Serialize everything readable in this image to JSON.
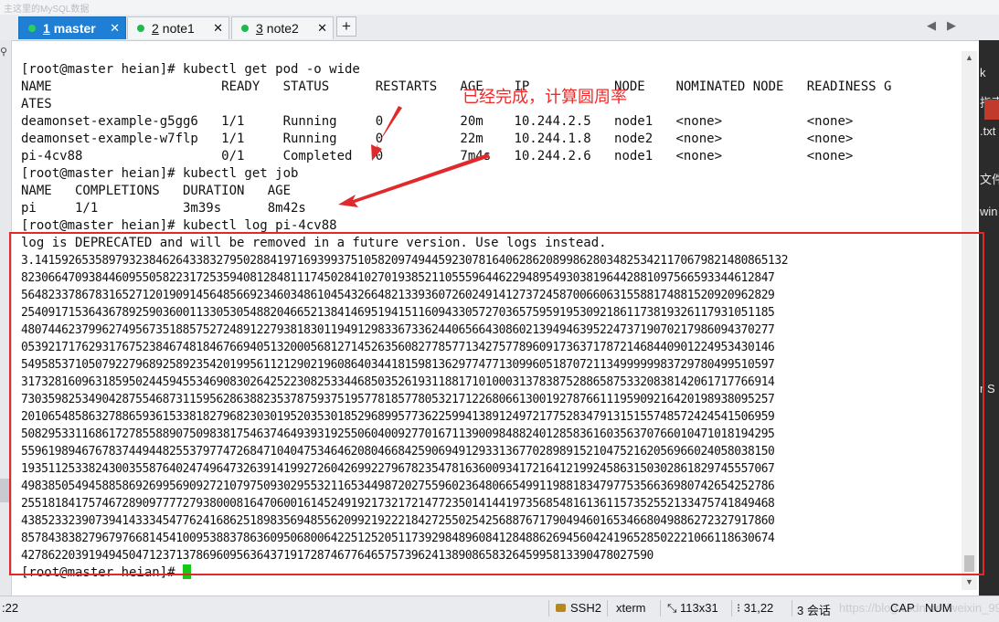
{
  "topbar": {
    "text": "主这里的MySQL数据"
  },
  "tabs": [
    {
      "number": "1",
      "label": "master",
      "active": true
    },
    {
      "number": "2",
      "label": "note1",
      "active": false
    },
    {
      "number": "3",
      "label": "note2",
      "active": false
    }
  ],
  "new_tab_label": "+",
  "terminal": {
    "lines": [
      "[root@master heian]# kubectl get pod -o wide",
      "NAME                      READY   STATUS      RESTARTS   AGE    IP           NODE    NOMINATED NODE   READINESS G",
      "ATES",
      "deamonset-example-g5gg6   1/1     Running     0          20m    10.244.2.5   node1   <none>           <none>",
      "deamonset-example-w7flp   1/1     Running     0          22m    10.244.1.8   node2   <none>           <none>",
      "pi-4cv88                  0/1     Completed   0          7m4s   10.244.2.6   node1   <none>           <none>",
      "[root@master heian]# kubectl get job",
      "NAME   COMPLETIONS   DURATION   AGE",
      "pi     1/1           3m39s      8m42s",
      "[root@master heian]# kubectl log pi-4cv88",
      "log is DEPRECATED and will be removed in a future version. Use logs instead."
    ],
    "pi_output": [
      "3.1415926535897932384626433832795028841971693993751058209749445923078164062862089986280348253421170679821480865132",
      "8230664709384460955058223172535940812848111745028410270193852110555964462294895493038196442881097566593344612847",
      "5648233786783165271201909145648566923460348610454326648213393607260249141273724587006606315588174881520920962829",
      "2540917153643678925903600113305305488204665213841469519415116094330572703657595919530921861173819326117931051185",
      "4807446237996274956735188575272489122793818301194912983367336244065664308602139494639522473719070217986094370277",
      "0539217176293176752384674818467669405132000568127145263560827785771342757789609173637178721468440901224953430146",
      "5495853710507922796892589235420199561121290219608640344181598136297747713099605187072113499999983729780499510597",
      "3173281609631859502445945534690830264252230825334468503526193118817101000313783875288658753320838142061717766914",
      "7303598253490428755468731159562863882353787593751957781857780532171226806613001927876611195909216420198938095257",
      "2010654858632788659361533818279682303019520353018529689957736225994138912497217752834791315155748572424541506959",
      "5082953311686172785588907509838175463746493931925506040092770167113900984882401285836160356370766010471018194295",
      "5596198946767837449448255379774726847104047534646208046684259069491293313677028989152104752162056966024058038150",
      "1935112533824300355876402474964732639141992726042699227967823547816360093417216412199245863150302861829745557067",
      "4983850549458858692699569092721079750930295532116534498720275596023648066549911988183479775356636980742654252786",
      "2551818417574672890977772793800081647060016145249192173217214772350141441973568548161361157352552133475741849468",
      "4385233239073941433345477624168625189835694855620992192221842725502542568876717904946016534668049886272327917860",
      "8578438382796797668145410095388378636095068006422512520511739298489608412848862694560424196528502221066118630674",
      "4278622039194945047123713786960956364371917287467764657573962413890865832645995813390478027590",
      "1"
    ],
    "final_prompt": "[root@master heian]# "
  },
  "annotation": {
    "text": "已经完成，计算圆周率"
  },
  "right_panel_text": [
    "k",
    "指南",
    ".txt",
    "文件",
    "win",
    "r S"
  ],
  "status_bar": {
    "left": ":22",
    "protocol": "SSH2",
    "term_type": "xterm",
    "size": "113x31",
    "cursor_pos": "31,22",
    "sessions": "3 会话",
    "caps": "CAP",
    "num": "NUM",
    "watermark": "https://blog.csdn.net/weixin_99"
  },
  "colors": {
    "active_tab": "#1e7fd4",
    "status_dot": "#1fb94f",
    "cursor": "#17c917",
    "annotation": "#e0292b"
  }
}
